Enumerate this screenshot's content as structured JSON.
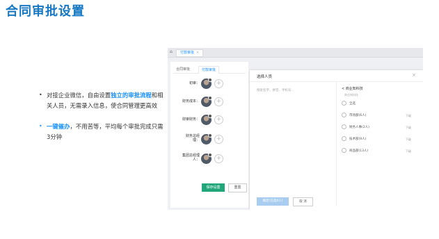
{
  "page_title": "合同审批设置",
  "bullets": [
    {
      "p1": "对接企业微信，自由设置",
      "highlight": "独立的审批流程",
      "p2": "和相关人员，无需录入信息，使合同管理更高效"
    },
    {
      "highlight": "一键催办",
      "p2": "，不用苦等，平均每个审批完成只需3分钟"
    }
  ],
  "screenshot": {
    "home_icon": "home-icon",
    "open_tab": "付款审批",
    "tabs": [
      "合同审批",
      "付款审批"
    ],
    "approvers": [
      {
        "label": "初审："
      },
      {
        "label": "财务成本："
      },
      {
        "label": "财审财务："
      },
      {
        "label": "财务总经理："
      },
      {
        "label": "集团总经理人："
      }
    ],
    "save_button": "保存设置",
    "reset_button": "重置",
    "modal": {
      "title": "选择人员",
      "close": "×",
      "search_placeholder": "搜索名字、拼音、手机号...",
      "org_title": "< 商业知科技",
      "org_subtitle": "商业知科技",
      "rows": [
        {
          "label": "全选",
          "sub": ""
        },
        {
          "label": "市场部(6人)",
          "sub": "下级"
        },
        {
          "label": "财务人事(2人)",
          "sub": "下级"
        },
        {
          "label": "技术部(9人)",
          "sub": "下级"
        },
        {
          "label": "商品部(13人)",
          "sub": "下级"
        }
      ],
      "confirm": "确定(已选0人)",
      "cancel": "取 消"
    }
  },
  "colors": {
    "title": "#1678c2",
    "highlight": "#1890ff",
    "save": "#21a67a"
  }
}
